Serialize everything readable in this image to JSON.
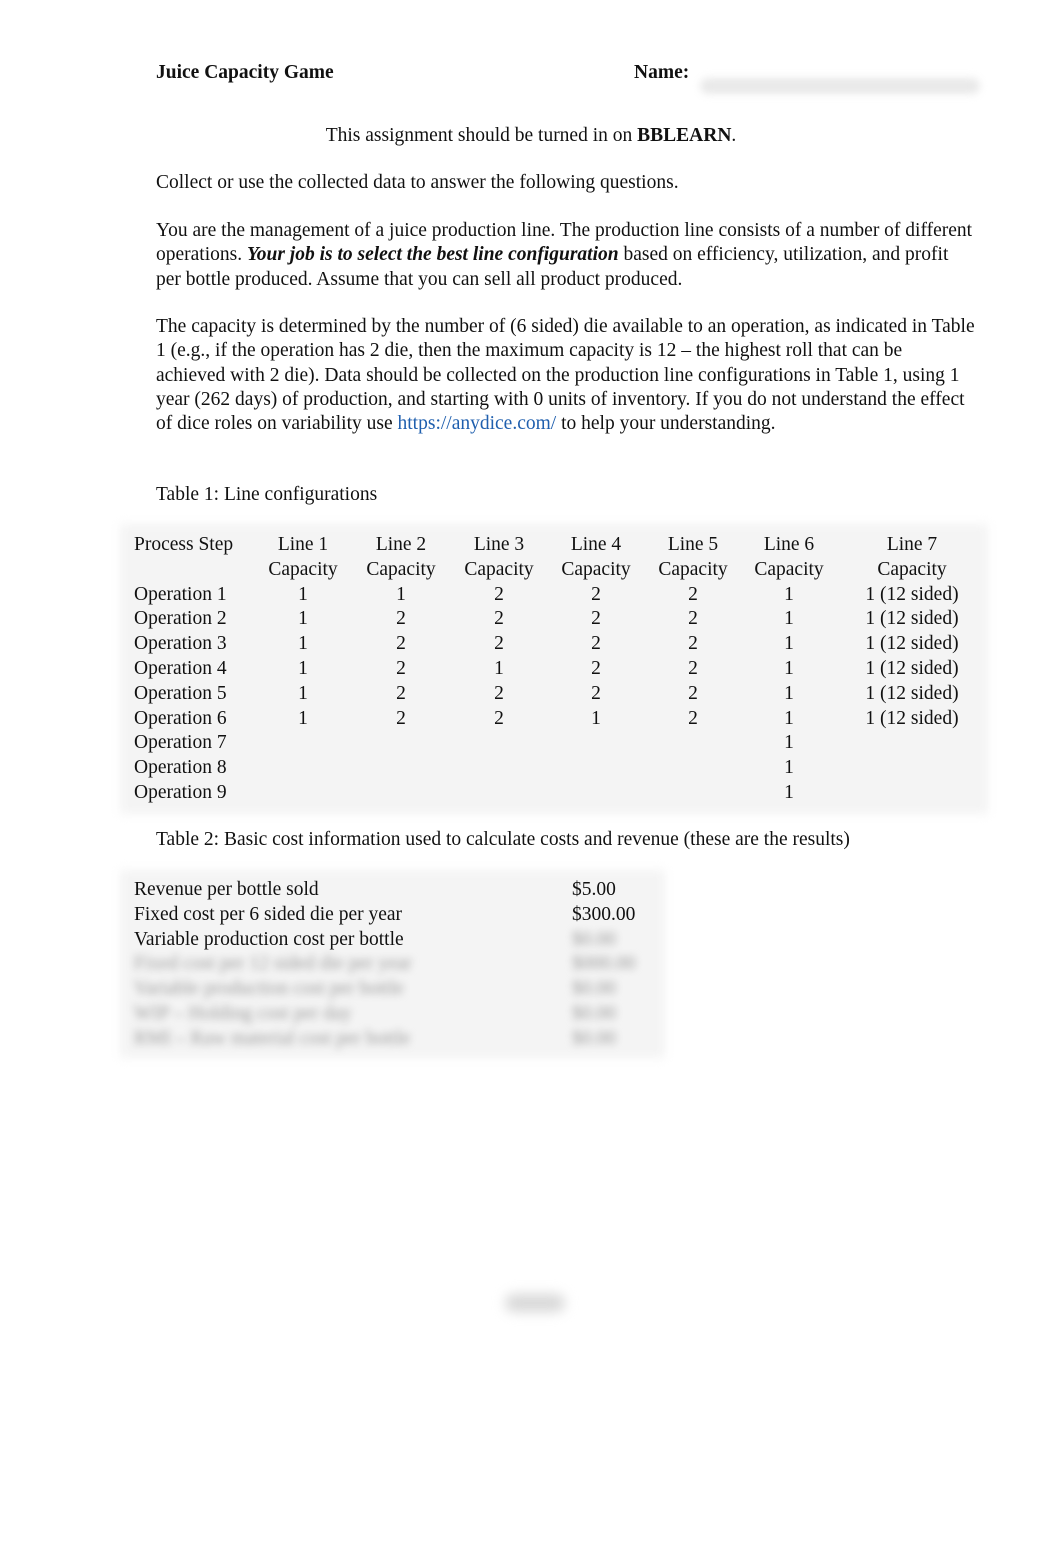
{
  "header": {
    "title": "Juice Capacity Game",
    "name_label": "Name:",
    "name_value": ""
  },
  "submission": {
    "prefix": "This assignment should be turned in on ",
    "platform": "BBLEARN",
    "suffix": "."
  },
  "paragraphs": {
    "intro": "Collect or use the collected data to answer the following questions.",
    "role_part1": "You are the management of a juice production line. The production line consists of a number of different operations. ",
    "role_emphasis": "Your job is to select the best line configuration",
    "role_part2": " based on efficiency, utilization, and profit per bottle produced. Assume that you can sell all product produced.",
    "capacity_part1": "The capacity is determined by the number of (6 sided) die available to an operation, as indicated in Table 1 (e.g., if the operation has 2 die, then the maximum capacity is 12 – the highest roll that can be achieved with 2 die). Data should be collected on the production line configurations in Table 1, using 1 year (262 days) of production, and starting with 0 units of inventory. If you do not understand the effect of dice roles on variability use ",
    "capacity_link": "https://anydice.com/",
    "capacity_part2": " to help your understanding."
  },
  "table1": {
    "caption": "Table 1: Line configurations",
    "headers": [
      [
        "Process Step",
        ""
      ],
      [
        "Line 1",
        "Capacity"
      ],
      [
        "Line 2",
        "Capacity"
      ],
      [
        "Line 3",
        "Capacity"
      ],
      [
        "Line 4",
        "Capacity"
      ],
      [
        "Line 5",
        "Capacity"
      ],
      [
        "Line 6",
        "Capacity"
      ],
      [
        "Line 7",
        "Capacity"
      ]
    ],
    "rows": [
      [
        "Operation 1",
        "1",
        "1",
        "2",
        "2",
        "2",
        "1",
        "1 (12 sided)"
      ],
      [
        "Operation 2",
        "1",
        "2",
        "2",
        "2",
        "2",
        "1",
        "1 (12 sided)"
      ],
      [
        "Operation 3",
        "1",
        "2",
        "2",
        "2",
        "2",
        "1",
        "1 (12 sided)"
      ],
      [
        "Operation 4",
        "1",
        "2",
        "1",
        "2",
        "2",
        "1",
        "1 (12 sided)"
      ],
      [
        "Operation 5",
        "1",
        "2",
        "2",
        "2",
        "2",
        "1",
        "1 (12 sided)"
      ],
      [
        "Operation 6",
        "1",
        "2",
        "2",
        "1",
        "2",
        "1",
        "1 (12 sided)"
      ],
      [
        "Operation 7",
        "",
        "",
        "",
        "",
        "",
        "1",
        ""
      ],
      [
        "Operation 8",
        "",
        "",
        "",
        "",
        "",
        "1",
        ""
      ],
      [
        "Operation 9",
        "",
        "",
        "",
        "",
        "",
        "1",
        ""
      ]
    ]
  },
  "table2": {
    "caption": "Table 2: Basic cost information used to calculate costs and revenue (these are the results)",
    "rows": [
      {
        "label": "Revenue per bottle sold",
        "value": "$5.00",
        "redacted": false
      },
      {
        "label": "Fixed cost per 6 sided die per year",
        "value": "$300.00",
        "redacted": false
      },
      {
        "label": "Variable production cost per bottle",
        "value": "$0.00",
        "redacted_value": true
      },
      {
        "label": "Fixed cost per 12 sided die per year",
        "value": "$000.00",
        "redacted": true
      },
      {
        "label": "Variable production cost per bottle",
        "value": "$0.00",
        "redacted": true
      },
      {
        "label": "WIP – Holding cost per day",
        "value": "$0.00",
        "redacted": true
      },
      {
        "label": "RMI – Raw material cost per bottle",
        "value": "$0.00",
        "redacted": true
      }
    ]
  },
  "footer": {
    "page_label": "1 of 4"
  }
}
